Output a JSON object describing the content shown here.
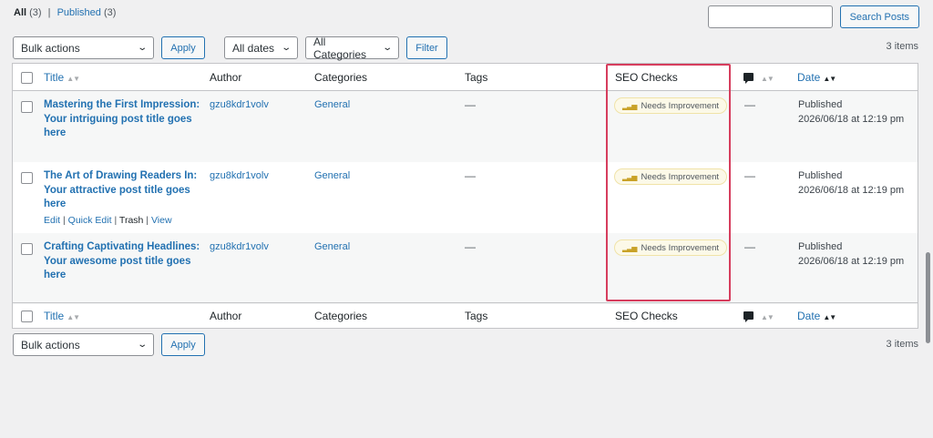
{
  "filters": {
    "all_label": "All",
    "all_count": "(3)",
    "separator": "|",
    "published_label": "Published",
    "published_count": "(3)"
  },
  "search": {
    "button_label": "Search Posts",
    "value": ""
  },
  "top_nav": {
    "bulk_actions": "Bulk actions",
    "apply": "Apply",
    "dates": "All dates",
    "categories": "All Categories",
    "filter": "Filter",
    "items_count": "3 items"
  },
  "columns": {
    "title": "Title",
    "author": "Author",
    "categories": "Categories",
    "tags": "Tags",
    "seo": "SEO Checks",
    "date": "Date"
  },
  "posts": [
    {
      "title": "Mastering the First Impression: Your intriguing post title goes here",
      "author": "gzu8kdr1volv",
      "category": "General",
      "tags": "—",
      "seo": "Needs Improvement",
      "comments": "—",
      "status": "Published",
      "date": "2026/06/18 at 12:19 pm"
    },
    {
      "title": "The Art of Drawing Readers In: Your attractive post title goes here",
      "author": "gzu8kdr1volv",
      "category": "General",
      "tags": "—",
      "seo": "Needs Improvement",
      "comments": "—",
      "status": "Published",
      "date": "2026/06/18 at 12:19 pm",
      "row_actions": {
        "edit": "Edit",
        "quick_edit": "Quick Edit",
        "trash": "Trash",
        "view": "View",
        "sep": "|"
      }
    },
    {
      "title": "Crafting Captivating Headlines: Your awesome post title goes here",
      "author": "gzu8kdr1volv",
      "category": "General",
      "tags": "—",
      "seo": "Needs Improvement",
      "comments": "—",
      "status": "Published",
      "date": "2026/06/18 at 12:19 pm"
    }
  ],
  "bottom_nav": {
    "bulk_actions": "Bulk actions",
    "apply": "Apply",
    "items_count": "3 items"
  },
  "icons": {
    "sort": "sort-arrows-icon",
    "comment": "comment-bubble-icon",
    "seo_bars": "signal-bars-icon",
    "chevron": "chevron-down-icon"
  },
  "colors": {
    "highlight": "#d63d5d",
    "link": "#2271b1",
    "badge_bg": "#fcf9e8"
  }
}
